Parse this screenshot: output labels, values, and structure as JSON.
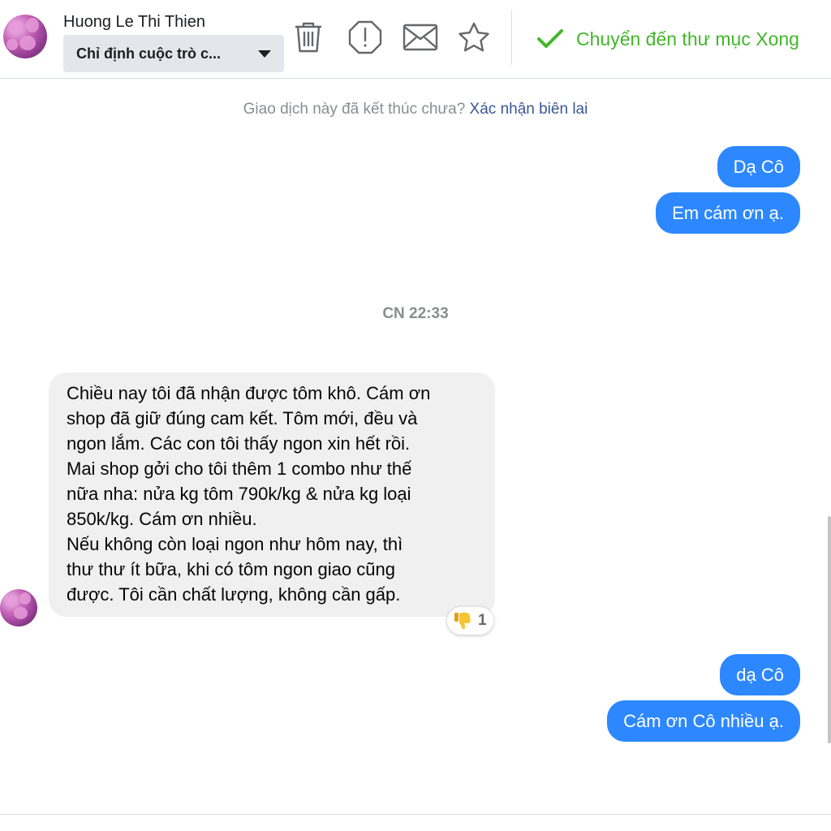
{
  "header": {
    "contact_name": "Huong Le Thi Thien",
    "assign_label": "Chỉ định cuộc trò c...",
    "tools": [
      "trash-icon",
      "report-icon",
      "mail-icon",
      "star-icon"
    ],
    "done_label": "Chuyển đến thư mục Xong",
    "accent_green": "#42b72a"
  },
  "system_prompt": {
    "text": "Giao dịch này đã kết thúc chưa?",
    "link": "Xác nhận biên lai"
  },
  "messages_top": [
    {
      "text": "Dạ Cô"
    },
    {
      "text": "Em cám ơn ạ."
    }
  ],
  "timestamp": "CN 22:33",
  "incoming": {
    "text": "Chiều nay tôi đã nhận được tôm khô. Cám ơn\nshop đã giữ đúng cam kết. Tôm mới, đều và\nngon lắm. Các con tôi thấy ngon xin hết rồi.\nMai shop gởi cho tôi thêm 1 combo như thế\nnữa nha: nửa kg tôm 790k/kg & nửa kg loại\n850k/kg. Cám ơn nhiều.\nNếu không còn loại ngon như hôm nay, thì\nthư thư ít bữa, khi có tôm ngon giao cũng\nđược. Tôi cần chất lượng, không cần gấp.",
    "reaction_icon": "thumbs-down-icon",
    "reaction_count": "1"
  },
  "messages_bottom": [
    {
      "text": "dạ Cô"
    },
    {
      "text": "Cám ơn Cô nhiều ạ."
    }
  ],
  "colors": {
    "outgoing_bubble": "#2d88ff",
    "incoming_bubble": "#f0f0f0",
    "link": "#385898"
  }
}
